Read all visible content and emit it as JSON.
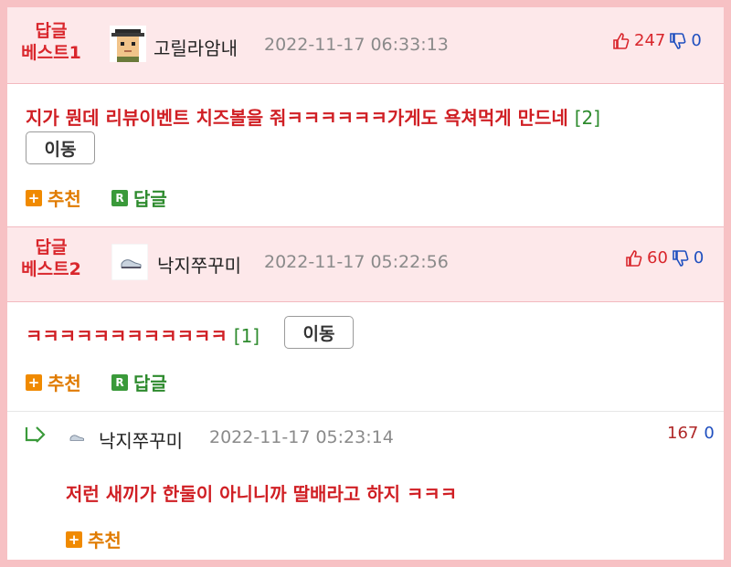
{
  "comments": [
    {
      "best_label_line1": "답글",
      "best_label_line2": "베스트1",
      "nickname": "고릴라암내",
      "date": "2022-11-17 06:33:13",
      "upvotes": "247",
      "downvotes": "0",
      "text": "지가 뭔데 리뷰이벤트 치즈볼을 줘ㅋㅋㅋㅋㅋㅋ가게도 욕쳐먹게 만드네",
      "reply_count": "[2]",
      "move_label": "이동",
      "recommend_label": "추천",
      "reply_label": "답글"
    },
    {
      "best_label_line1": "답글",
      "best_label_line2": "베스트2",
      "nickname": "낙지쭈꾸미",
      "date": "2022-11-17 05:22:56",
      "upvotes": "60",
      "downvotes": "0",
      "text": "ㅋㅋㅋㅋㅋㅋㅋㅋㅋㅋㅋㅋ",
      "reply_count": "[1]",
      "move_label": "이동",
      "recommend_label": "추천",
      "reply_label": "답글"
    }
  ],
  "reply": {
    "nickname": "낙지쭈꾸미",
    "date": "2022-11-17 05:23:14",
    "upvotes": "167",
    "downvotes": "0",
    "text": "저런 새끼가 한둘이 아니니까 딸배라고 하지 ㅋㅋㅋ",
    "recommend_label": "추천"
  },
  "icons": {
    "thumbs_up": "thumbs-up-icon",
    "thumbs_down": "thumbs-down-icon",
    "plus": "plus-box-icon",
    "reply_badge": "R",
    "reply_arrow": "reply-arrow-icon"
  },
  "colors": {
    "frame": "#f7c1c4",
    "header_bg": "#fde8ea",
    "accent_red": "#d9262c",
    "vote_blue": "#1f4fbf",
    "recommend_orange": "#f08a00",
    "reply_green": "#3a9a3a"
  }
}
